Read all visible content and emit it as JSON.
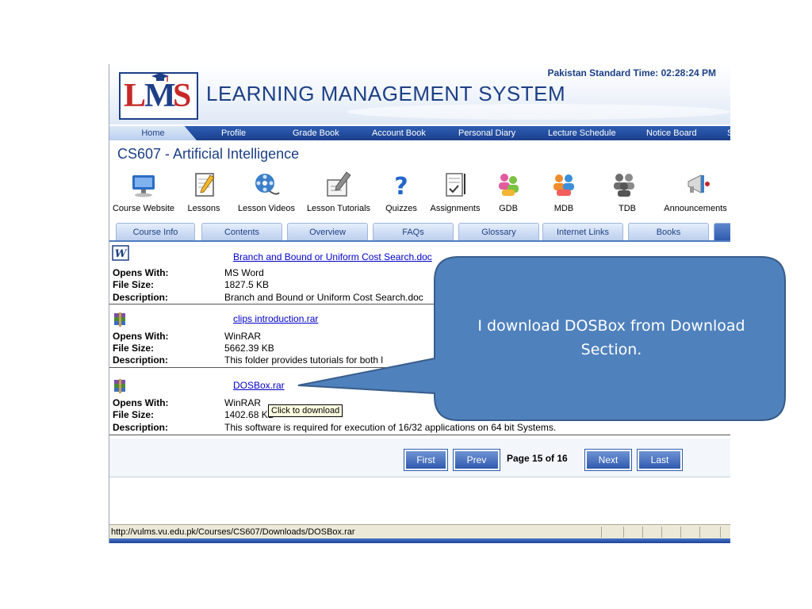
{
  "header": {
    "system_title": "LEARNING MANAGEMENT SYSTEM",
    "logo_text": "LMS",
    "clock": "Pakistan Standard Time: 02:28:24  PM",
    "colors": {
      "navy": "#1d3f86",
      "red": "#c62828"
    }
  },
  "nav": {
    "items": [
      "Home",
      "Profile",
      "Grade Book",
      "Account Book",
      "Personal Diary",
      "Lecture Schedule",
      "Notice Board",
      "S"
    ]
  },
  "course": {
    "title": "CS607 - Artificial Intelligence"
  },
  "toolbar": {
    "items": [
      {
        "label": "Course Website",
        "icon": "monitor-icon"
      },
      {
        "label": "Lessons",
        "icon": "notepad-icon"
      },
      {
        "label": "Lesson Videos",
        "icon": "film-reel-icon"
      },
      {
        "label": "Lesson Tutorials",
        "icon": "document-pencil-icon"
      },
      {
        "label": "Quizzes",
        "icon": "question-icon"
      },
      {
        "label": "Assignments",
        "icon": "assignment-icon"
      },
      {
        "label": "GDB",
        "icon": "group-icon"
      },
      {
        "label": "MDB",
        "icon": "group-icon"
      },
      {
        "label": "TDB",
        "icon": "group-gray-icon"
      },
      {
        "label": "Announcements",
        "icon": "megaphone-icon"
      }
    ]
  },
  "tabs": {
    "items": [
      "Course Info",
      "Contents",
      "Overview",
      "FAQs",
      "Glossary",
      "Internet Links",
      "Books",
      ""
    ]
  },
  "files": [
    {
      "name": "Branch and Bound or Uniform Cost Search.doc",
      "icon": "word-doc-icon",
      "opens_with": "MS Word",
      "size": "1827.5 KB",
      "description": "Branch and Bound or Uniform Cost Search.doc"
    },
    {
      "name": "clips introduction.rar",
      "icon": "winrar-icon",
      "opens_with": "WinRAR",
      "size": "5662.39 KB",
      "description": "This folder provides tutorials for both l"
    },
    {
      "name": "DOSBox.rar",
      "icon": "winrar-icon",
      "opens_with": "WinRAR",
      "size": "1402.68 KB",
      "description": "This software is required for execution of 16/32 applications on 64 bit Systems."
    }
  ],
  "labels": {
    "opens_with": "Opens With:",
    "file_size": "File Size:",
    "description": "Description:"
  },
  "tooltip": "Click to download",
  "pager": {
    "first": "First",
    "prev": "Prev",
    "info": "Page 15 of 16",
    "next": "Next",
    "last": "Last"
  },
  "status": {
    "url": "http://vulms.vu.edu.pk/Courses/CS607/Downloads/DOSBox.rar"
  },
  "callout": {
    "text": "I download DOSBox from Download Section.",
    "fill": "#4f81bd",
    "stroke": "#385d8a"
  }
}
